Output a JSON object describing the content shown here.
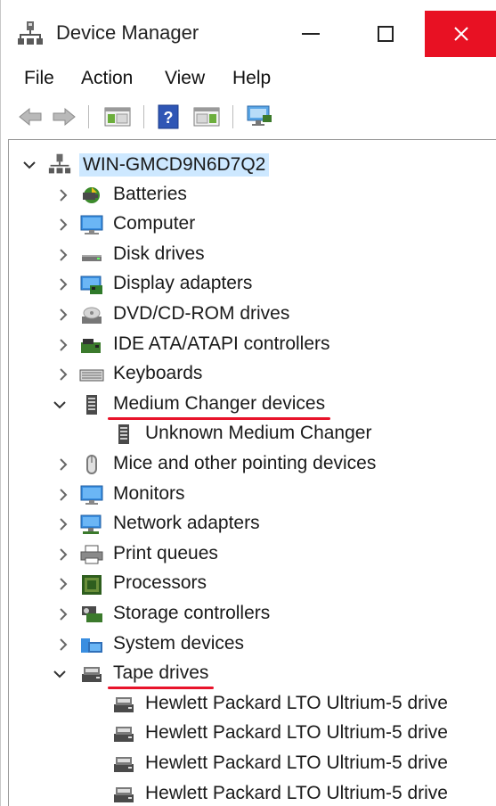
{
  "window": {
    "title": "Device Manager",
    "minimize_symbol": "—",
    "close_symbol": "✕"
  },
  "menu": [
    "File",
    "Action",
    "View",
    "Help"
  ],
  "toolbar": {
    "buttons": [
      "back-icon",
      "forward-icon",
      "show-hide-console-tree-icon",
      "help-icon",
      "action-pane-icon",
      "scan-hardware-icon"
    ],
    "help_glyph": "?"
  },
  "tree": {
    "root": {
      "label": "WIN-GMCD9N6D7Q2",
      "expanded": true
    },
    "categories": [
      {
        "label": "Batteries",
        "icon": "battery-icon",
        "expanded": false
      },
      {
        "label": "Computer",
        "icon": "computer-icon",
        "expanded": false
      },
      {
        "label": "Disk drives",
        "icon": "disk-drive-icon",
        "expanded": false
      },
      {
        "label": "Display adapters",
        "icon": "display-adapter-icon",
        "expanded": false
      },
      {
        "label": "DVD/CD-ROM drives",
        "icon": "dvd-drive-icon",
        "expanded": false
      },
      {
        "label": "IDE ATA/ATAPI controllers",
        "icon": "ide-controller-icon",
        "expanded": false
      },
      {
        "label": "Keyboards",
        "icon": "keyboard-icon",
        "expanded": false
      },
      {
        "label": "Medium Changer devices",
        "icon": "medium-changer-icon",
        "expanded": true,
        "underlined": true,
        "children": [
          {
            "label": "Unknown Medium Changer",
            "icon": "medium-changer-icon"
          }
        ]
      },
      {
        "label": "Mice and other pointing devices",
        "icon": "mouse-icon",
        "expanded": false
      },
      {
        "label": "Monitors",
        "icon": "monitor-icon",
        "expanded": false
      },
      {
        "label": "Network adapters",
        "icon": "network-adapter-icon",
        "expanded": false
      },
      {
        "label": "Print queues",
        "icon": "printer-icon",
        "expanded": false
      },
      {
        "label": "Processors",
        "icon": "processor-icon",
        "expanded": false
      },
      {
        "label": "Storage controllers",
        "icon": "storage-controller-icon",
        "expanded": false
      },
      {
        "label": "System devices",
        "icon": "system-devices-icon",
        "expanded": false
      },
      {
        "label": "Tape drives",
        "icon": "tape-drive-icon",
        "expanded": true,
        "underlined": true,
        "children": [
          {
            "label": "Hewlett Packard LTO Ultrium-5 drive",
            "icon": "tape-drive-icon"
          },
          {
            "label": "Hewlett Packard LTO Ultrium-5 drive",
            "icon": "tape-drive-icon"
          },
          {
            "label": "Hewlett Packard LTO Ultrium-5 drive",
            "icon": "tape-drive-icon"
          },
          {
            "label": "Hewlett Packard LTO Ultrium-5 drive",
            "icon": "tape-drive-icon"
          }
        ]
      }
    ]
  },
  "colors": {
    "close_button": "#e81123",
    "selection": "#cde8ff",
    "annotation_underline": "#e8132a"
  }
}
